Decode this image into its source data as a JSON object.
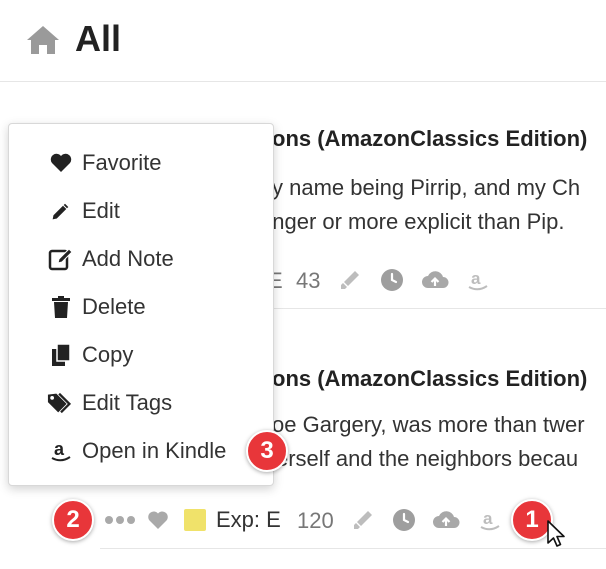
{
  "header": {
    "title": "All",
    "icon": "home-icon"
  },
  "cards": [
    {
      "title": "ons (AmazonClassics Edition)",
      "lines": [
        "y name being Pirrip, and my Ch",
        "onger or more explicit than Pip."
      ],
      "tag_fragment": "E",
      "count": "43"
    },
    {
      "title": "ons (AmazonClassics Edition)",
      "lines": [
        "oe Gargery, was more than twer",
        "erself and the neighbors becau"
      ],
      "tag_label": "Exp: E",
      "count": "120"
    }
  ],
  "menu": {
    "items": [
      {
        "label": "Favorite",
        "icon": "heart-icon"
      },
      {
        "label": "Edit",
        "icon": "pencil-icon"
      },
      {
        "label": "Add Note",
        "icon": "note-edit-icon"
      },
      {
        "label": "Delete",
        "icon": "trash-icon"
      },
      {
        "label": "Copy",
        "icon": "copy-icon"
      },
      {
        "label": "Edit Tags",
        "icon": "tags-icon"
      },
      {
        "label": "Open in Kindle",
        "icon": "amazon-icon"
      }
    ]
  },
  "badges": [
    "1",
    "2",
    "3"
  ],
  "colors": {
    "badge": "#e8363a",
    "icon_gray": "#999999",
    "tag_yellow": "#f0e26a",
    "text_dark": "#222222"
  }
}
